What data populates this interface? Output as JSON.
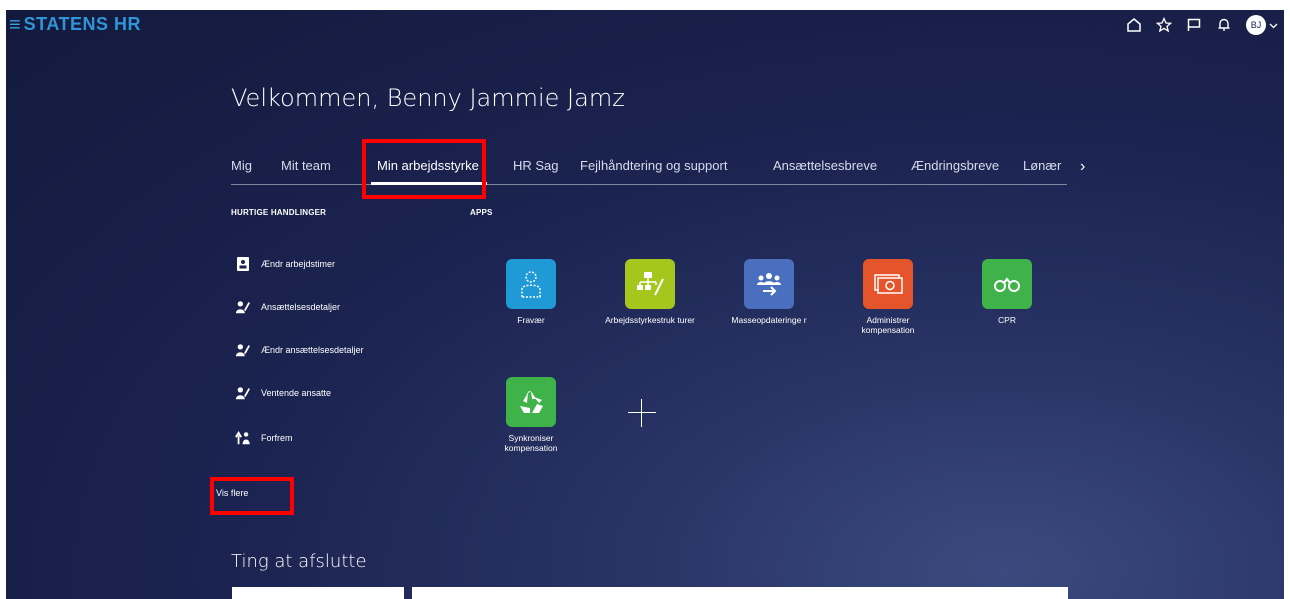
{
  "header": {
    "menu_icon": "hamburger-icon",
    "brand": "STATENS HR",
    "avatar_initials": "BJ",
    "icons": [
      "home-icon",
      "star-icon",
      "flag-icon",
      "bell-icon",
      "chevron-down-icon"
    ]
  },
  "welcome": "Velkommen, Benny Jammie Jamz",
  "tabs": [
    "Mig",
    "Mit team",
    "Min arbejdsstyrke",
    "HR Sag",
    "Fejlhåndtering og support",
    "Ansættelsesbreve",
    "Ændringsbreve",
    "Lønær"
  ],
  "active_tab": "Min arbejdsstyrke",
  "quick_actions": {
    "title": "HURTIGE HANDLINGER",
    "items": [
      "Ændr arbejdstimer",
      "Ansættelsesdetaljer",
      "Ændr ansættelsesdetaljer",
      "Ventende ansatte",
      "Forfrem"
    ],
    "show_more": "Vis flere"
  },
  "apps": {
    "title": "APPS",
    "items": [
      {
        "label": "Fravær",
        "color": "#1f9ad6",
        "icon": "person-outline-icon"
      },
      {
        "label": "Arbejdsstyrkestruk turer",
        "color": "#a5c61d",
        "icon": "org-chart-icon"
      },
      {
        "label": "Masseopdateringe r",
        "color": "#4a6fbf",
        "icon": "group-update-icon"
      },
      {
        "label": "Administrer kompensation",
        "color": "#e5542a",
        "icon": "money-icon"
      },
      {
        "label": "CPR",
        "color": "#3fb24a",
        "icon": "binoculars-icon"
      },
      {
        "label": "Synkroniser kompensation",
        "color": "#3fb24a",
        "icon": "recycle-icon"
      }
    ]
  },
  "things_to_finish": "Ting at afslutte",
  "colors": {
    "highlight": "#ff0000",
    "brand": "#2f95d8"
  }
}
